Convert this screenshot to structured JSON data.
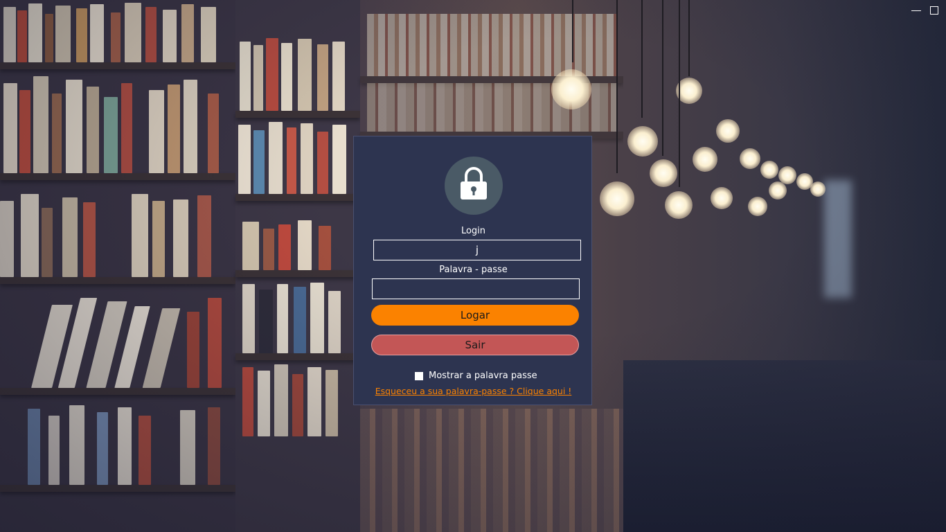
{
  "window": {
    "minimize_icon": "minimize-icon",
    "maximize_icon": "maximize-icon"
  },
  "login_panel": {
    "lock_icon": "padlock-icon",
    "login_label": "Login",
    "login_value": "j",
    "password_label": "Palavra - passe",
    "password_value": "",
    "login_button": "Logar",
    "exit_button": "Sair",
    "show_password_label": "Mostrar a palavra passe",
    "show_password_checked": false,
    "forgot_link": "Esqueceu a sua palavra-passe ? Clique aqui !"
  },
  "colors": {
    "panel_bg": "#2d3450",
    "lock_circle": "#4a5a66",
    "login_button": "#fb8200",
    "exit_button": "#c35656",
    "link": "#fb8200"
  }
}
